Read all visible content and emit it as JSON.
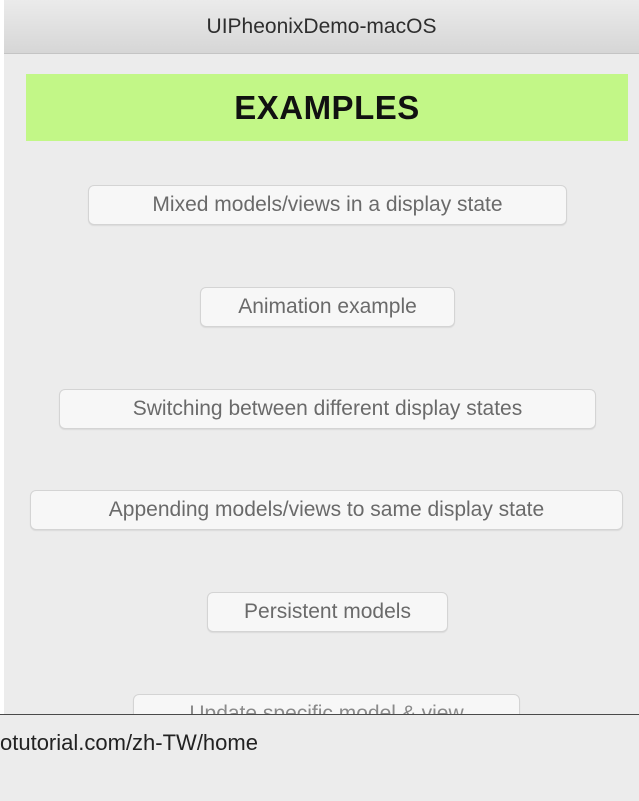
{
  "window": {
    "title": "UIPheonixDemo-macOS"
  },
  "header": {
    "title": "EXAMPLES",
    "background_color": "#c2f787"
  },
  "buttons": [
    {
      "label": "Mixed models/views in a display state"
    },
    {
      "label": "Animation example"
    },
    {
      "label": "Switching between different display states"
    },
    {
      "label": "Appending models/views to same display state"
    },
    {
      "label": "Persistent models"
    },
    {
      "label": "Update specific model & view"
    }
  ],
  "overlay": {
    "url_text": "otutorial.com/zh-TW/home"
  }
}
